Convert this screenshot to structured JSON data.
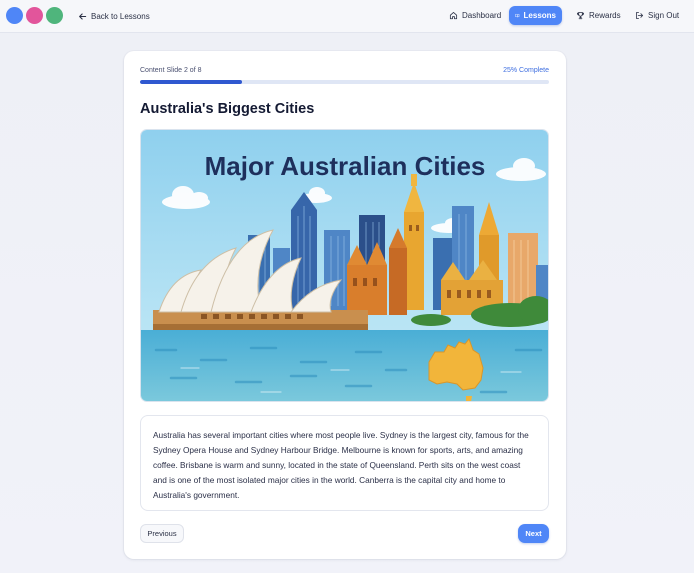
{
  "colors": {
    "dot_1": "#4f86f7",
    "dot_2": "#e2559b",
    "dot_3": "#4fb57c",
    "accent": "#4f86f7",
    "progress_fill": "#2f58d0"
  },
  "nav": {
    "back_label": "Back to Lessons",
    "dashboard_label": "Dashboard",
    "lessons_label": "Lessons",
    "rewards_label": "Rewards",
    "signout_label": "Sign Out",
    "icons": {
      "back": "arrow-left-icon",
      "dashboard": "home-icon",
      "lessons": "book-icon",
      "rewards": "trophy-icon",
      "signout": "sign-out-icon"
    }
  },
  "lesson": {
    "slide_label": "Content Slide 2 of 8",
    "complete_label": "25% Complete",
    "progress_fraction": 0.25,
    "title": "Australia's Biggest Cities",
    "image_heading": "Major Australian Cities",
    "body_text": "Australia has several important cities where most people live. Sydney is the largest city, famous for the Sydney Opera House and Sydney Harbour Bridge. Melbourne is known for sports, arts, and amazing coffee. Brisbane is warm and sunny, located in the state of Queensland. Perth sits on the west coast and is one of the most isolated major cities in the world. Canberra is the capital city and home to Australia's government.",
    "prev_label": "Previous",
    "next_label": "Next"
  }
}
